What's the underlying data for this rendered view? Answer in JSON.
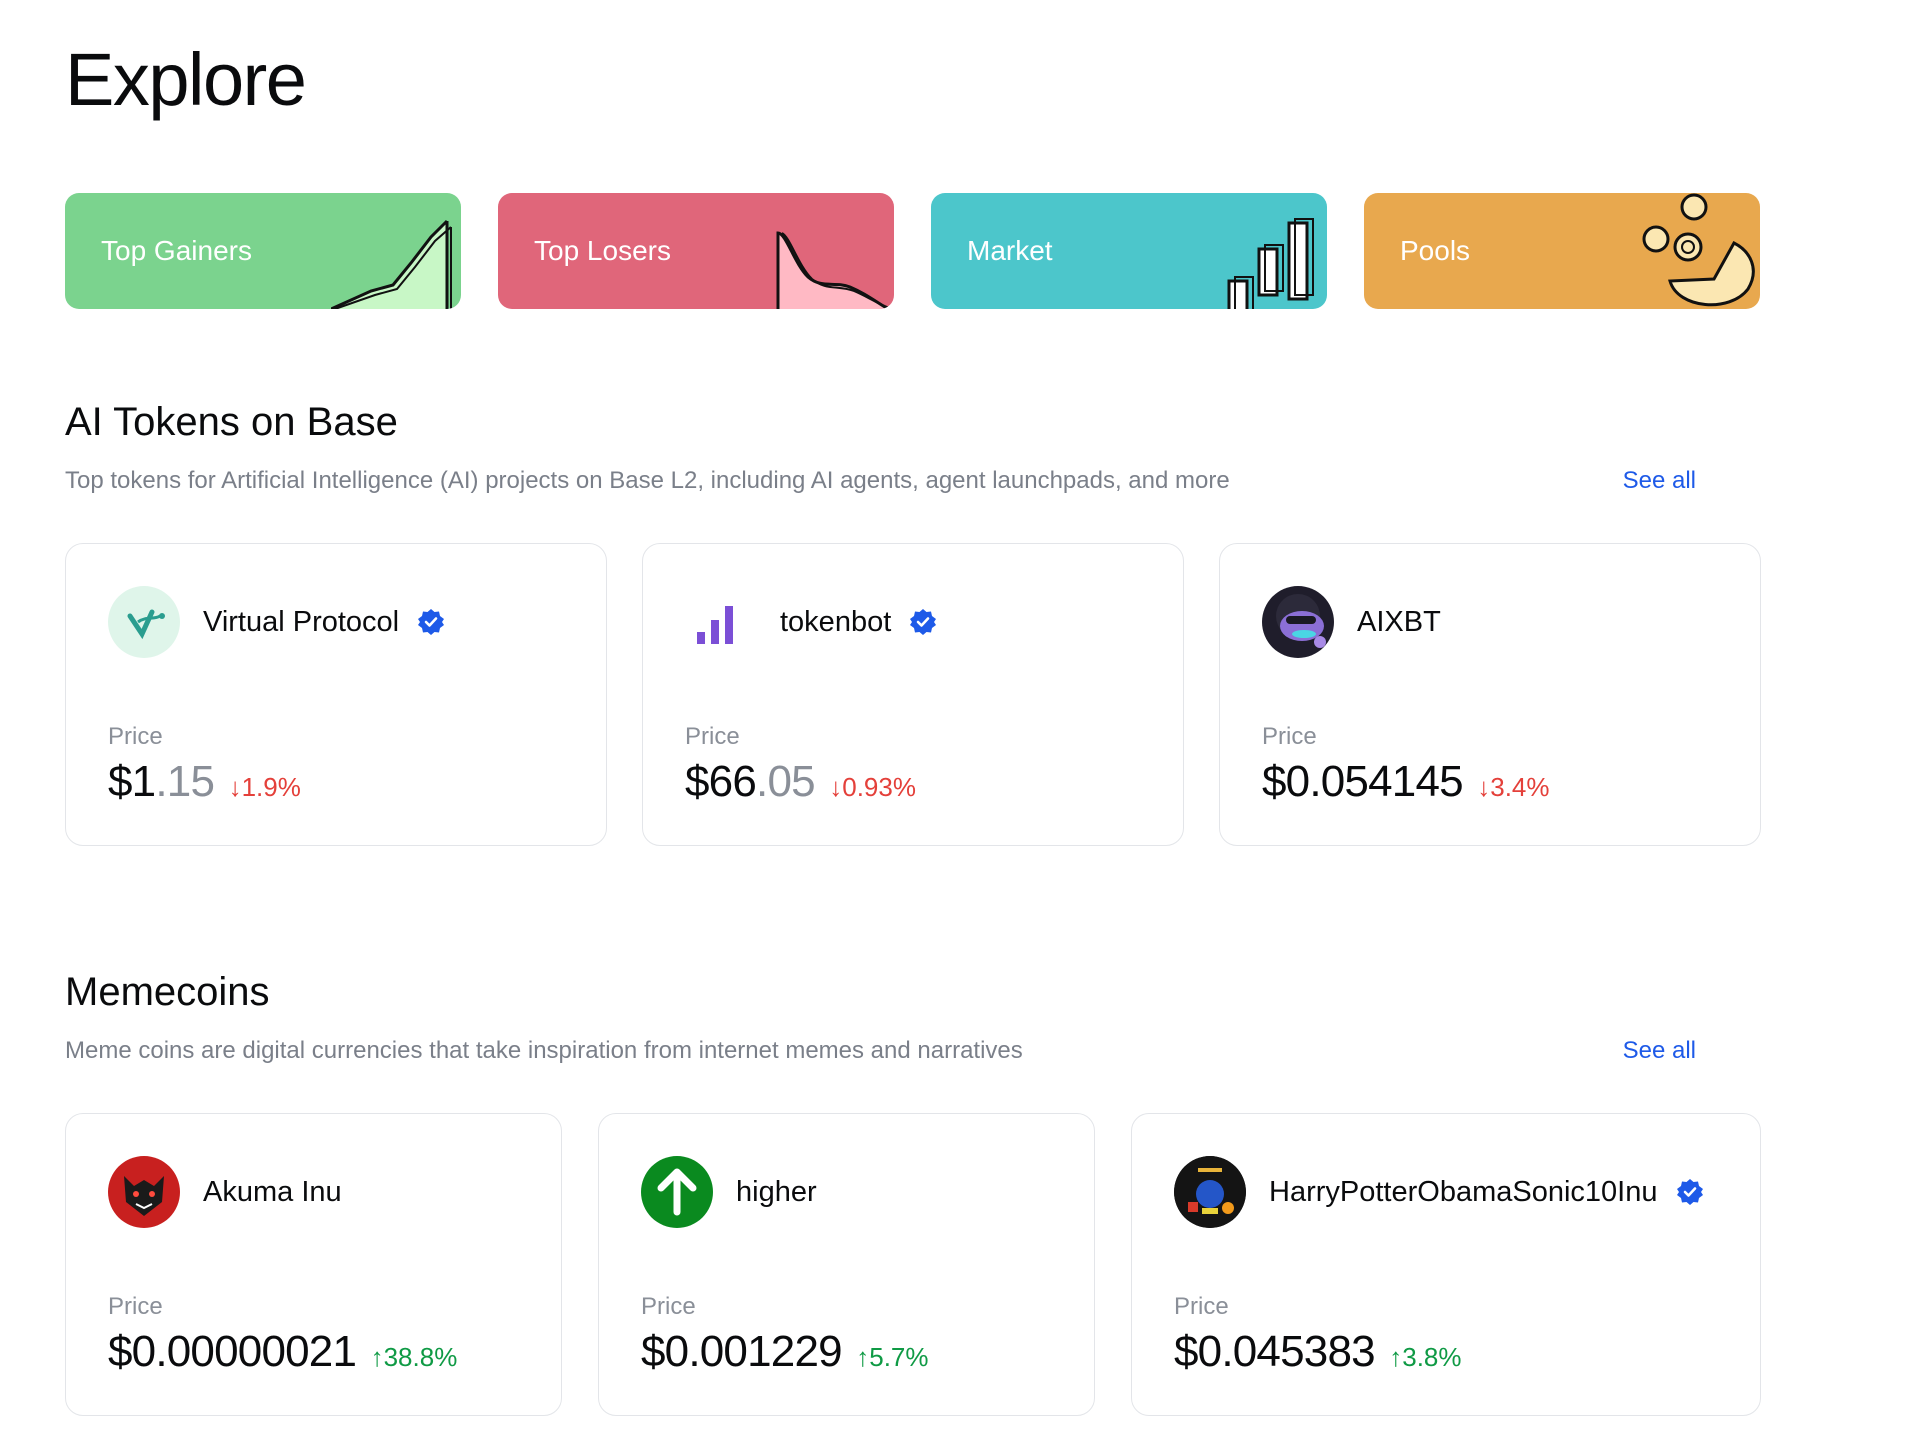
{
  "page": {
    "title": "Explore"
  },
  "categories": [
    {
      "label": "Top Gainers",
      "color": "#7bd38e",
      "icon": "line-up-chart-icon"
    },
    {
      "label": "Top Losers",
      "color": "#e0667a",
      "icon": "line-down-chart-icon"
    },
    {
      "label": "Market",
      "color": "#4cc6cb",
      "icon": "bar-chart-icon"
    },
    {
      "label": "Pools",
      "color": "#e8a84e",
      "icon": "coins-pie-icon"
    }
  ],
  "ai_section": {
    "title": "AI Tokens on Base",
    "description": "Top tokens for Artificial Intelligence (AI) projects on Base L2, including AI agents, agent launchpads, and more",
    "see_all": "See all",
    "tokens": [
      {
        "name": "Virtual Protocol",
        "verified": true,
        "price_label": "Price",
        "price_main": "$1",
        "price_dec": ".15",
        "change": "↓1.9%",
        "direction": "down"
      },
      {
        "name": "tokenbot",
        "verified": true,
        "price_label": "Price",
        "price_main": "$66",
        "price_dec": ".05",
        "change": "↓0.93%",
        "direction": "down"
      },
      {
        "name": "AIXBT",
        "verified": false,
        "price_label": "Price",
        "price_main": "$0.054145",
        "price_dec": "",
        "change": "↓3.4%",
        "direction": "down"
      }
    ]
  },
  "meme_section": {
    "title": "Memecoins",
    "description": "Meme coins are digital currencies that take inspiration from internet memes and narratives",
    "see_all": "See all",
    "tokens": [
      {
        "name": "Akuma Inu",
        "verified": false,
        "price_label": "Price",
        "price_main": "$0.00000021",
        "price_dec": "",
        "change": "↑38.8%",
        "direction": "up"
      },
      {
        "name": "higher",
        "verified": false,
        "price_label": "Price",
        "price_main": "$0.001229",
        "price_dec": "",
        "change": "↑5.7%",
        "direction": "up"
      },
      {
        "name": "HarryPotterObamaSonic10Inu",
        "verified": true,
        "price_label": "Price",
        "price_main": "$0.045383",
        "price_dec": "",
        "change": "↑3.8%",
        "direction": "up"
      }
    ]
  },
  "colors": {
    "accent": "#1e5ae8",
    "positive": "#0f9a45",
    "negative": "#e4403a",
    "muted": "#7a7f89"
  }
}
